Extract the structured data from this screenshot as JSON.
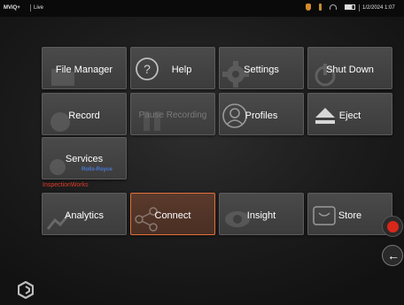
{
  "statusbar": {
    "app": "MViQ+",
    "mode": "Live",
    "datetime": "1/2/2024 1:07"
  },
  "tiles": {
    "file_manager": "File Manager",
    "help": "Help",
    "settings": "Settings",
    "shut_down": "Shut Down",
    "record": "Record",
    "pause_recording": "Pause Recording",
    "profiles": "Profiles",
    "eject": "Eject",
    "services": "Services",
    "services_sub": "Rolls-Royce",
    "analytics": "Analytics",
    "connect": "Connect",
    "insight": "Insight",
    "store": "Store"
  },
  "section_label": "InspectionWorks",
  "colors": {
    "selected_border": "#e0703a",
    "record": "#d9271a",
    "section_label": "#e03a26",
    "sub_label": "#4a78d8"
  }
}
